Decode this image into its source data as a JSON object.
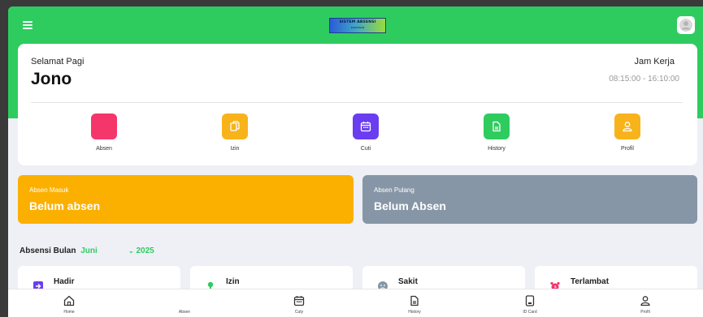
{
  "header": {
    "logo_title": "SISTEM ABSENSI",
    "logo_subtitle": "KARYAWAN"
  },
  "greeting": {
    "label": "Selamat Pagi",
    "name": "Jono",
    "jam_kerja_label": "Jam Kerja",
    "jam_kerja_value": "08:15:00 - 16:10:00"
  },
  "menu": [
    {
      "label": "Absen",
      "color": "#f5366b",
      "icon": "absen-icon"
    },
    {
      "label": "Izin",
      "color": "#f8b31b",
      "icon": "document-copy-icon"
    },
    {
      "label": "Cuti",
      "color": "#6a3df0",
      "icon": "calendar-icon"
    },
    {
      "label": "History",
      "color": "#2ecc5f",
      "icon": "document-icon"
    },
    {
      "label": "Profil",
      "color": "#f8b31b",
      "icon": "user-icon"
    }
  ],
  "status": {
    "masuk": {
      "label": "Absen Masuk",
      "value": "Belum absen",
      "color": "#fbb000"
    },
    "pulang": {
      "label": "Absen Pulang",
      "value": "Belum Absen",
      "color": "#8796a6"
    }
  },
  "month_filter": {
    "label": "Absensi Bulan",
    "month": "Juni",
    "year": "2025"
  },
  "stats": [
    {
      "label": "Hadir",
      "icon": "login-icon"
    },
    {
      "label": "Izin",
      "icon": "location-pin-icon"
    },
    {
      "label": "Sakit",
      "icon": "sad-face-icon"
    },
    {
      "label": "Terlambat",
      "icon": "alarm-icon"
    }
  ],
  "bottom_nav": [
    {
      "label": "Home",
      "icon": "home-icon"
    },
    {
      "label": "Absen",
      "icon": ""
    },
    {
      "label": "Cuty",
      "icon": "calendar-icon"
    },
    {
      "label": "History",
      "icon": "document-icon"
    },
    {
      "label": "ID Card",
      "icon": "id-card-icon"
    },
    {
      "label": "Profil",
      "icon": "user-icon"
    }
  ]
}
